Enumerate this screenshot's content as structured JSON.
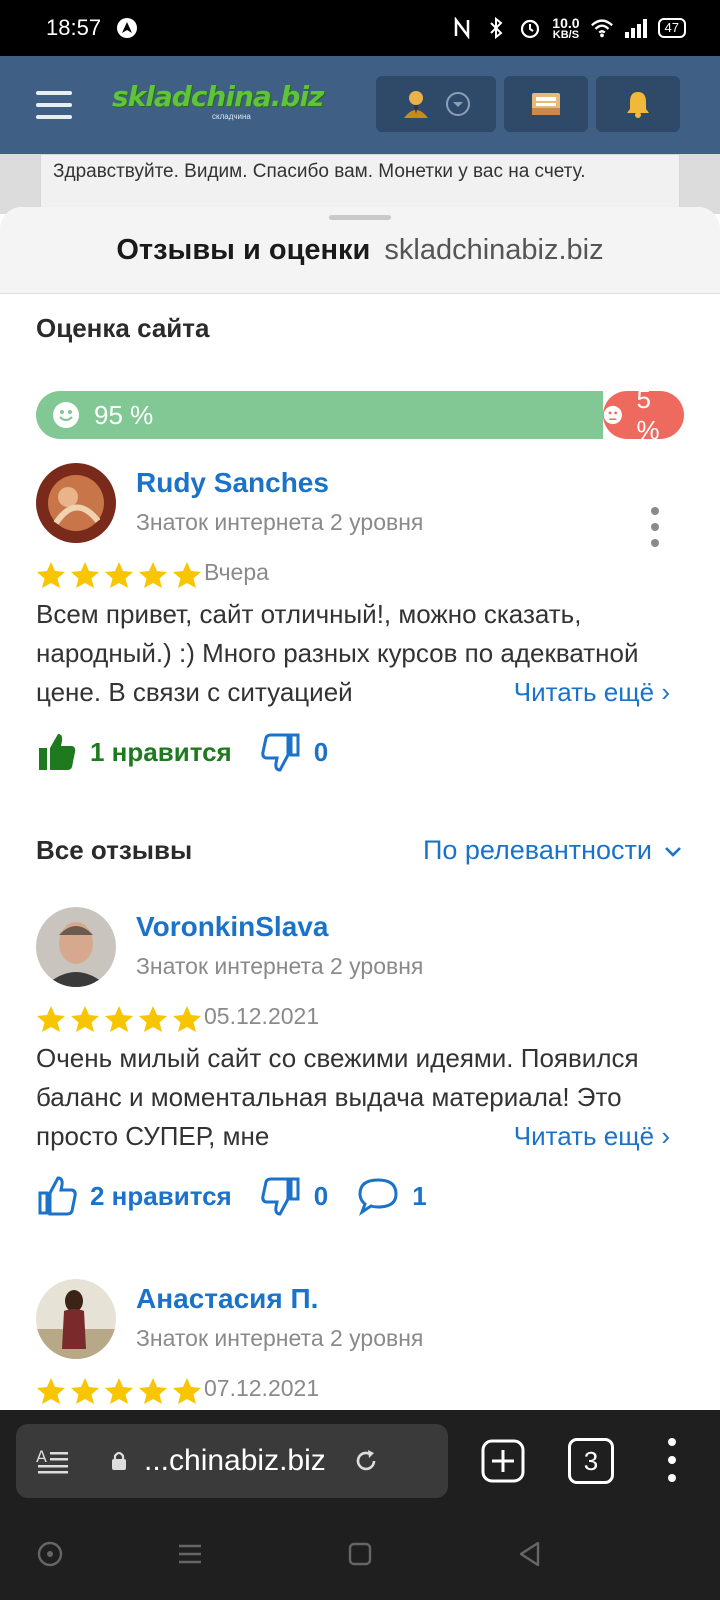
{
  "status_bar": {
    "time": "18:57",
    "net_speed_value": "10.0",
    "net_speed_unit": "KB/S",
    "battery": "47"
  },
  "site": {
    "logo_text": "skladchina.biz",
    "logo_tagline": "складчина"
  },
  "background_page": {
    "message": "Здравствуйте. Видим. Спасибо вам. Монетки у вас на счету."
  },
  "sheet": {
    "title": "Отзывы и оценки",
    "domain": "skladchinabiz.biz"
  },
  "rating": {
    "section_title": "Оценка сайта",
    "positive_label": "95 %",
    "negative_label": "5 %",
    "positive_fraction": 0.95,
    "positive_color": "#82c895",
    "negative_color": "#ee6a5f"
  },
  "featured_review": {
    "author": "Rudy Sanches",
    "level": "Знаток интернета 2 уровня",
    "stars": 5,
    "date": "Вчера",
    "text": "Всем привет, сайт отличный!, можно сказать, народный.) :) Много разных курсов по адекватной цене. В связи с ситуацией",
    "read_more": "Читать ещё",
    "likes": "1 нравится",
    "dislikes": "0"
  },
  "all_reviews": {
    "section_title": "Все отзывы",
    "sort_label": "По релевантности",
    "items": [
      {
        "author": "VoronkinSlava",
        "level": "Знаток интернета 2 уровня",
        "stars": 5,
        "date": "05.12.2021",
        "text": "Очень милый сайт со свежими идеями. Появился баланс и моментальная выдача материала! Это просто СУПЕР, мне",
        "read_more": "Читать ещё",
        "likes": "2 нравится",
        "dislikes": "0",
        "comments": "1"
      },
      {
        "author": "Анастасия П.",
        "level": "Знаток интернета 2 уровня",
        "stars": 5,
        "date": "07.12.2021"
      }
    ]
  },
  "browser": {
    "url": "...chinabiz.biz",
    "tab_count": "3"
  }
}
